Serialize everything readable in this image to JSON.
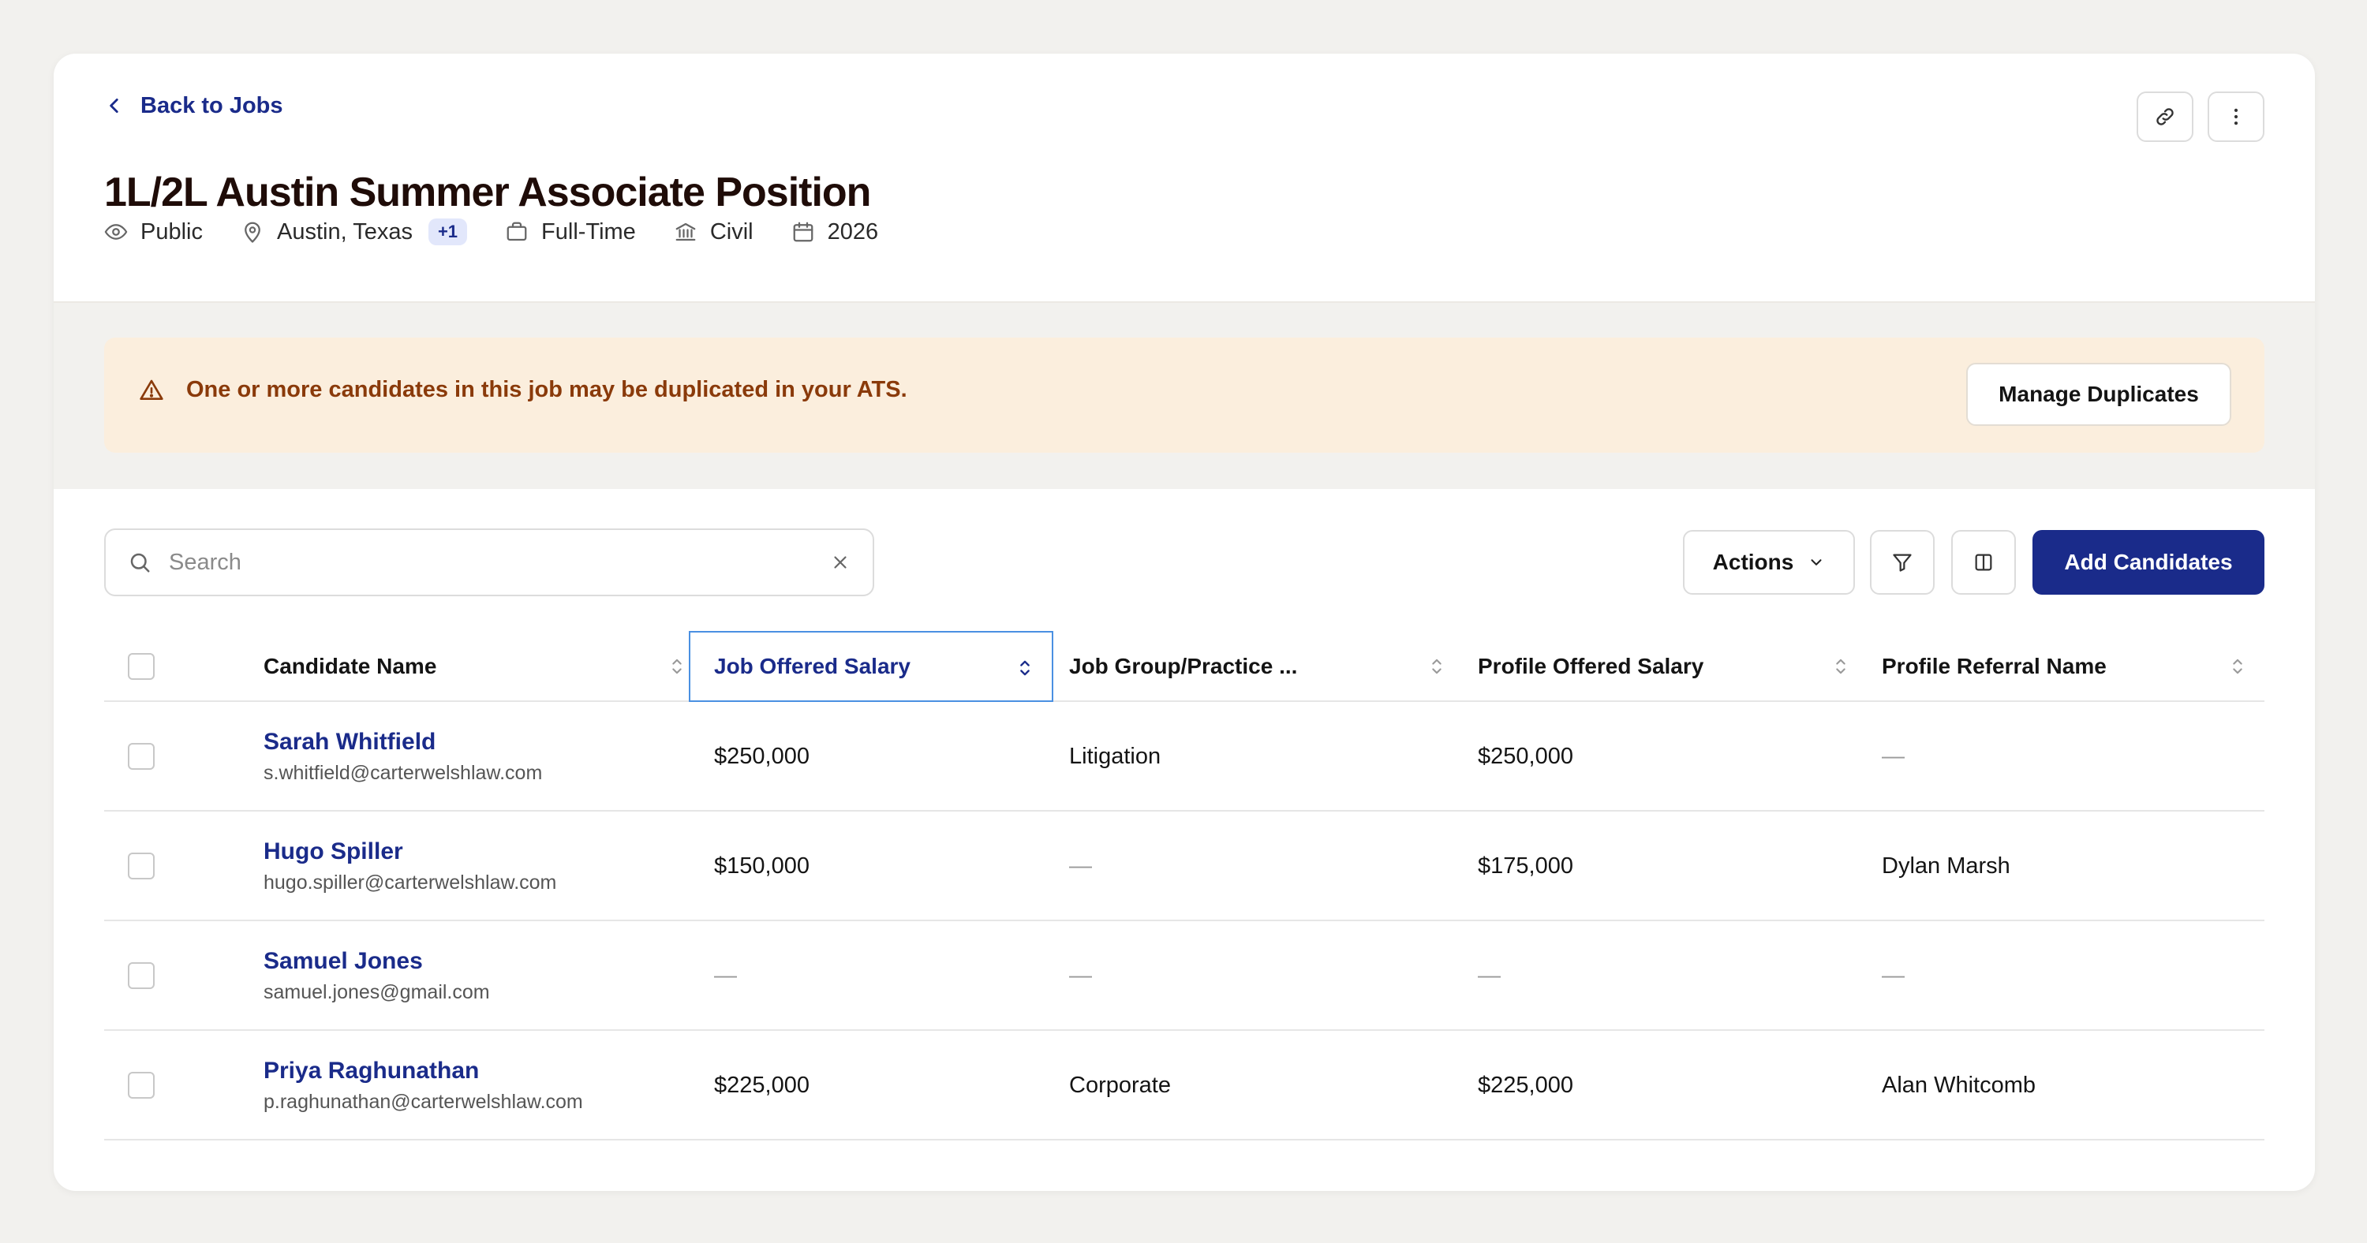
{
  "header": {
    "back_label": "Back to Jobs",
    "title": "1L/2L Austin Summer Associate Position",
    "meta": {
      "visibility": "Public",
      "location": "Austin, Texas",
      "location_extra": "+1",
      "employment_type": "Full-Time",
      "practice": "Civil",
      "year": "2026"
    }
  },
  "banner": {
    "message": "One or more candidates in this job may be duplicated in your ATS.",
    "button_label": "Manage Duplicates"
  },
  "toolbar": {
    "search_placeholder": "Search",
    "actions_label": "Actions",
    "add_label": "Add Candidates"
  },
  "table": {
    "columns": [
      "Candidate Name",
      "Job Offered Salary",
      "Job Group/Practice ...",
      "Profile Offered Salary",
      "Profile Referral Name"
    ],
    "rows": [
      {
        "name": "Sarah Whitfield",
        "email": "s.whitfield@carterwelshlaw.com",
        "job_salary": "$250,000",
        "group": "Litigation",
        "profile_salary": "$250,000",
        "referral": "—"
      },
      {
        "name": "Hugo Spiller",
        "email": "hugo.spiller@carterwelshlaw.com",
        "job_salary": "$150,000",
        "group": "—",
        "profile_salary": "$175,000",
        "referral": "Dylan Marsh"
      },
      {
        "name": "Samuel Jones",
        "email": "samuel.jones@gmail.com",
        "job_salary": "—",
        "group": "—",
        "profile_salary": "—",
        "referral": "—"
      },
      {
        "name": "Priya Raghunathan",
        "email": "p.raghunathan@carterwelshlaw.com",
        "job_salary": "$225,000",
        "group": "Corporate",
        "profile_salary": "$225,000",
        "referral": "Alan Whitcomb"
      }
    ]
  },
  "colors": {
    "brand": "#1a2b8a",
    "warning_bg": "#fbeedd",
    "warning_text": "#8a3a0a",
    "page_bg": "#f2f1ee"
  }
}
